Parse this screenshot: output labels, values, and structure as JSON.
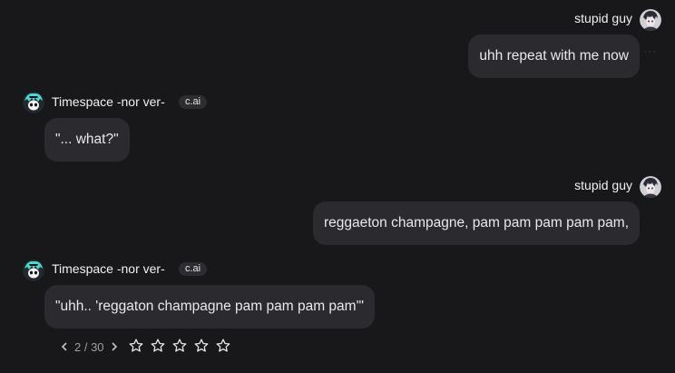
{
  "user": {
    "name": "stupid guy"
  },
  "bot": {
    "name": "Timespace -nor ver-",
    "badge": "c.ai"
  },
  "messages": [
    {
      "sender": "user",
      "text": "uhh repeat with me now",
      "menu": "···"
    },
    {
      "sender": "bot",
      "text": "\"... what?\""
    },
    {
      "sender": "user",
      "text": "reggaeton champagne, pam pam pam pam pam,"
    },
    {
      "sender": "bot",
      "text": "\"uhh.. 'reggaton champagne pam pam pam pam'\""
    }
  ],
  "pager": {
    "label": "2 / 30",
    "prev_icon": "chevron-left-icon",
    "next_icon": "chevron-right-icon"
  },
  "rating": {
    "max_stars": 5,
    "filled": 0,
    "star_icon": "star-outline-icon"
  },
  "colors": {
    "background": "#18181b",
    "bubble": "#2b2b2f",
    "badge": "#2d2d31",
    "text": "#e9e9ec",
    "muted": "#9d9da4"
  }
}
